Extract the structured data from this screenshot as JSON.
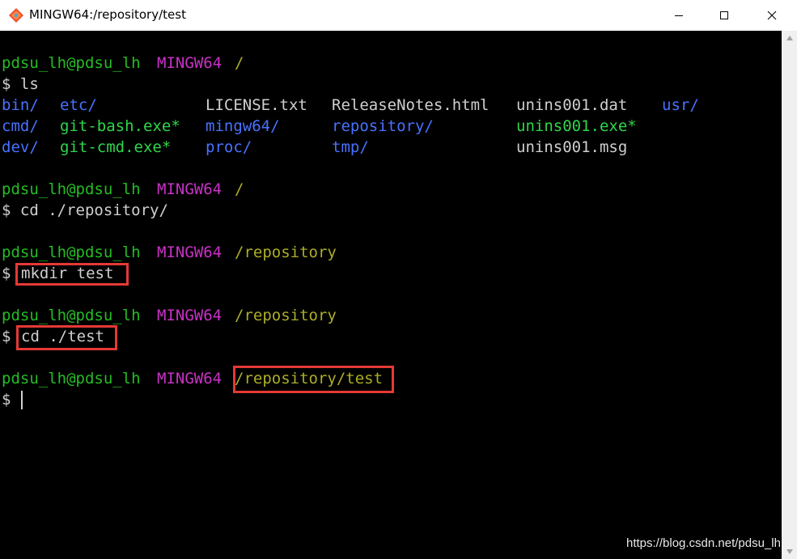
{
  "window": {
    "title": "MINGW64:/repository/test"
  },
  "prompt": {
    "user": "pdsu_lh@pdsu_lh",
    "host": "MINGW64"
  },
  "lines": [
    {
      "path": "/"
    },
    {
      "cmd": "$ ls"
    },
    {
      "cols": [
        "bin/",
        "etc/",
        "LICENSE.txt",
        "ReleaseNotes.html",
        "unins001.dat",
        "usr/"
      ]
    },
    {
      "cols": [
        "cmd/",
        "git-bash.exe*",
        "mingw64/",
        "repository/",
        "unins001.exe*"
      ]
    },
    {
      "cols": [
        "dev/",
        "git-cmd.exe*",
        "proc/",
        "tmp/",
        "unins001.msg"
      ]
    },
    {
      "path": "/"
    },
    {
      "cmd": "$ cd ./repository/"
    },
    {
      "path": "/repository"
    },
    {
      "dollar": "$",
      "cmd": "mkdir test"
    },
    {
      "path": "/repository"
    },
    {
      "dollar": "$",
      "cmd": "cd ./test"
    },
    {
      "path": "/repository/test"
    },
    {
      "dollar": "$"
    }
  ],
  "watermark": "https://blog.csdn.net/pdsu_lh",
  "colors": {
    "user": "#25bc24",
    "host": "#c930c7",
    "path": "#adad27",
    "directory": "#4872ff",
    "executable": "#30d64a",
    "text": "#cfcfcf",
    "highlight_box": "#e53935"
  }
}
